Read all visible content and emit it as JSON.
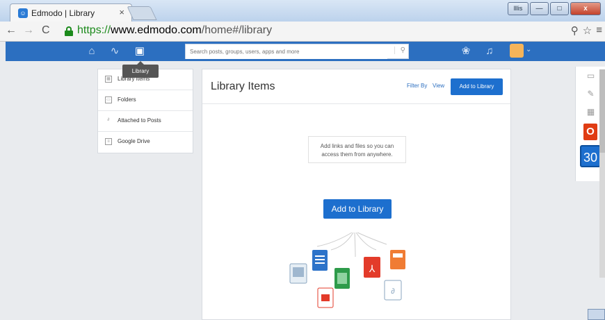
{
  "browser": {
    "tab_title": "Edmodo | Library",
    "tab_close": "×",
    "url_scheme": "https://",
    "url_host": "www.edmodo.com",
    "url_path": "/home#/library",
    "user_btn": "lllis"
  },
  "appbar": {
    "search_placeholder": "Search posts, groups, users, apps and more",
    "icons": [
      "home-icon",
      "activity-icon",
      "library-icon",
      "apps-icon",
      "bell-icon"
    ]
  },
  "tooltip": {
    "label": "Library"
  },
  "sidebar": {
    "items": [
      {
        "label": "Library Items",
        "icon": "grid-icon"
      },
      {
        "label": "Folders",
        "icon": "folder-icon"
      },
      {
        "label": "Attached to Posts",
        "icon": "paperclip-icon"
      },
      {
        "label": "Google Drive",
        "icon": "drive-icon"
      }
    ]
  },
  "panel": {
    "title": "Library Items",
    "filter_by": "Filter By",
    "view": "View",
    "add_small": "Add to Library",
    "hint_line1": "Add links and files so you can",
    "hint_line2": "access them from anywhere.",
    "add_big": "Add to Library"
  },
  "rightbar": {
    "calendar_day": "30"
  }
}
